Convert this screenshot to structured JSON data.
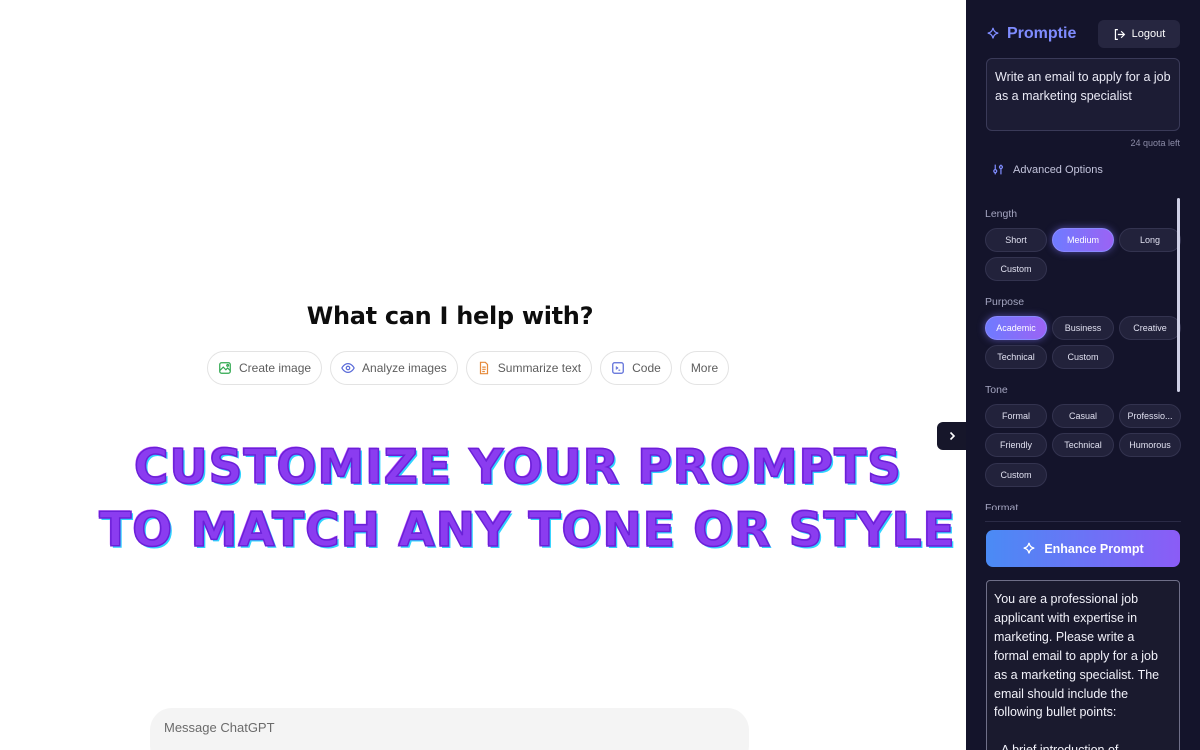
{
  "main": {
    "heading": "What can I help with?",
    "chips": [
      {
        "label": "Create image",
        "icon": "image-icon",
        "color": "#2fa84f"
      },
      {
        "label": "Analyze images",
        "icon": "eye-icon",
        "color": "#5a6bd8"
      },
      {
        "label": "Summarize text",
        "icon": "document-icon",
        "color": "#e6893a"
      },
      {
        "label": "Code",
        "icon": "code-icon",
        "color": "#5a6bd8"
      },
      {
        "label": "More",
        "icon": null
      }
    ],
    "composer_placeholder": "Message ChatGPT",
    "banner_line1": "Customize your prompts",
    "banner_line2": "to match any tone or style"
  },
  "panel": {
    "brand": "Promptie",
    "logout_label": "Logout",
    "prompt_text": "Write an email to apply for a job as a marketing specialist",
    "quota": "24 quota left",
    "advanced_label": "Advanced Options",
    "sections": [
      {
        "label": "Length",
        "options": [
          "Short",
          "Medium",
          "Long",
          "Custom"
        ],
        "selected": "Medium"
      },
      {
        "label": "Purpose",
        "options": [
          "Academic",
          "Business",
          "Creative",
          "Technical",
          "Custom"
        ],
        "selected": "Academic"
      },
      {
        "label": "Tone",
        "options": [
          "Formal",
          "Casual",
          "Professio...",
          "Friendly",
          "Technical",
          "Humorous",
          "Custom"
        ],
        "selected": null
      },
      {
        "label": "Format",
        "options": [],
        "selected": null
      }
    ],
    "enhance_label": "Enhance Prompt",
    "result_p1": "You are a professional job applicant with expertise in marketing. Please write a formal email to apply for a job as a marketing specialist. The email should include the following bullet points:",
    "result_p2": "- A brief introduction of"
  },
  "colors": {
    "panel_bg": "#14142b",
    "accent": "#7f8cff",
    "enhance_gradient_start": "#4a8bf5",
    "enhance_gradient_end": "#8b5cf6",
    "banner": "#8b3cf0"
  }
}
